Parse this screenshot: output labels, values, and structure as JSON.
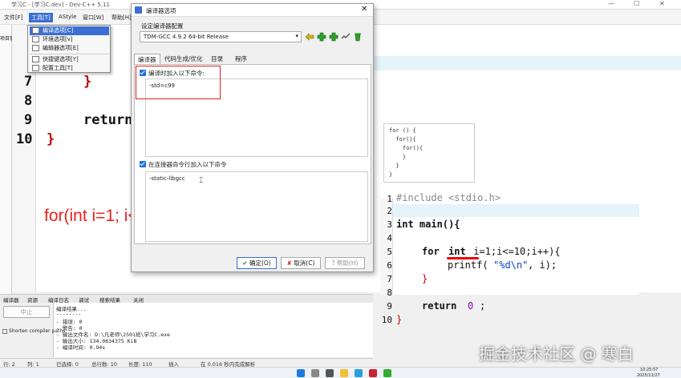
{
  "window": {
    "title": "学习C - [学习C.dev] - Dev-C++ 5.11",
    "controls": [
      "—",
      "☐",
      "✕"
    ]
  },
  "menu": {
    "items": [
      "文件[F]",
      "工具[T]",
      "AStyle",
      "窗口[W]",
      "帮助[H]"
    ],
    "active_index": 1
  },
  "left_panel": {
    "label": "项目管"
  },
  "tools_menu": {
    "items": [
      "编译选项[C]",
      "环境选项[v]",
      "编辑器选项[E]",
      "快捷键选项[Y]",
      "配置工具[T]"
    ],
    "selected_index": 0
  },
  "main_editor": {
    "line_numbers": [
      "7",
      "8",
      "9",
      "10"
    ],
    "lines": [
      {
        "text": "}"
      },
      {
        "text": ""
      },
      {
        "text": "return"
      },
      {
        "text": "}"
      }
    ]
  },
  "dialog": {
    "title": "编译器选项",
    "config_label": "设定编译器配置",
    "compiler_select": "TDM-GCC 4.9.2 64-bit Release",
    "tabs": [
      "编译器",
      "代码生成/优化",
      "目录",
      "程序"
    ],
    "active_tab": 0,
    "compile_check_label": "编译时加入以下命令:",
    "compile_command": "-std=c99",
    "linker_check_label": "在连接器命令行加入以下命令",
    "linker_command": "-static-libgcc",
    "ok_button": "确定(O)",
    "cancel_button": "取消(C)",
    "help_button": "帮助(H)"
  },
  "annotation": {
    "text": "for(int i=1; i<=100; i++)",
    "color": "#e8231f"
  },
  "snippet": {
    "lines": [
      "for () {",
      "  for(){",
      "    for(){",
      "    }",
      "  }",
      "}"
    ]
  },
  "second_editor": {
    "line_numbers": [
      "1",
      "2",
      "3",
      "4",
      "5",
      "6",
      "7",
      "8",
      "9",
      "10"
    ],
    "line1": "#include <stdio.h>",
    "line3": "int main(){",
    "line5_kw": "for",
    "line5_int": "int",
    "line5_rest": " i=1;i<=10;i++){",
    "line6_fn": "printf(",
    "line6_str": "\"%d\\n\"",
    "line6_rest": ", i);",
    "line7": "}",
    "line9_kw": "return",
    "line9_num": "0",
    "line9_semi": ";",
    "line10": "}"
  },
  "bottom_panel": {
    "tabs": [
      "编译器",
      "资源",
      "编译日志",
      "调试",
      "搜索结果",
      "关闭"
    ],
    "left_button": "中止",
    "shorten_label": "Shorten compiler paths",
    "output": [
      "编译结果...",
      "--------",
      "- 错误: 0",
      "- 警告: 0",
      "- 输出文件名: D:\\凡老师\\2501班\\学习C.exe",
      "- 输出大小: 134.0634375 KiB",
      "- 编译时间: 0.94s"
    ]
  },
  "statusbar": {
    "row": "行: 2",
    "col": "列: 1",
    "selected": "已选择: 0",
    "total": "总行数: 10",
    "length": "长度: 110",
    "insert": "插入",
    "parse": "在 0.016 秒内完成解析"
  },
  "taskbar": {
    "time": "10:25:57",
    "date": "2025/11/27"
  },
  "watermark": "掘金技术社区 @ 寒白",
  "colors": {
    "accent": "#3c6fd1",
    "annotation": "#e8231f",
    "keyword_blue": "#0a47c9"
  }
}
